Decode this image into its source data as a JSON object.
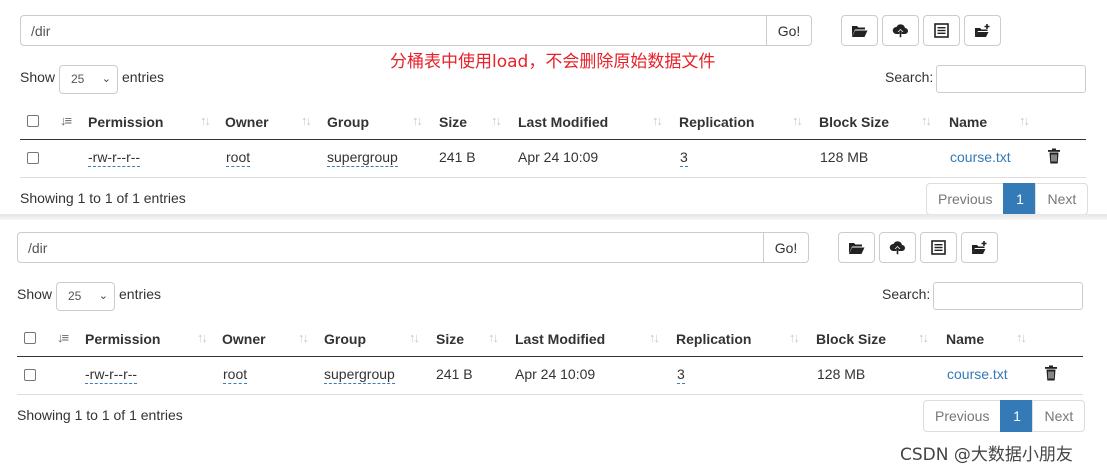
{
  "annotation": "分桶表中使用load，不会删除原始数据文件",
  "browser": {
    "path_value": "/dir",
    "go_label": "Go!",
    "show_label": "Show",
    "page_length": "25",
    "entries_label": "entries",
    "search_label": "Search:",
    "columns": [
      "Permission",
      "Owner",
      "Group",
      "Size",
      "Last Modified",
      "Replication",
      "Block Size",
      "Name"
    ],
    "rows": [
      {
        "permission": "-rw-r--r--",
        "owner": "root",
        "group": "supergroup",
        "size": "241 B",
        "last_modified": "Apr 24 10:09",
        "replication": "3",
        "block_size": "128 MB",
        "name": "course.txt"
      }
    ],
    "info": "Showing 1 to 1 of 1 entries",
    "pagination": {
      "previous": "Previous",
      "current": "1",
      "next": "Next"
    },
    "toolbar_icons": [
      "folder-open-icon",
      "cloud-upload-icon",
      "list-alt-icon",
      "folder-plus-icon"
    ]
  },
  "watermark": "CSDN @大数据小朋友",
  "colors": {
    "accent": "#337ab7",
    "annotation": "#e8212a"
  }
}
